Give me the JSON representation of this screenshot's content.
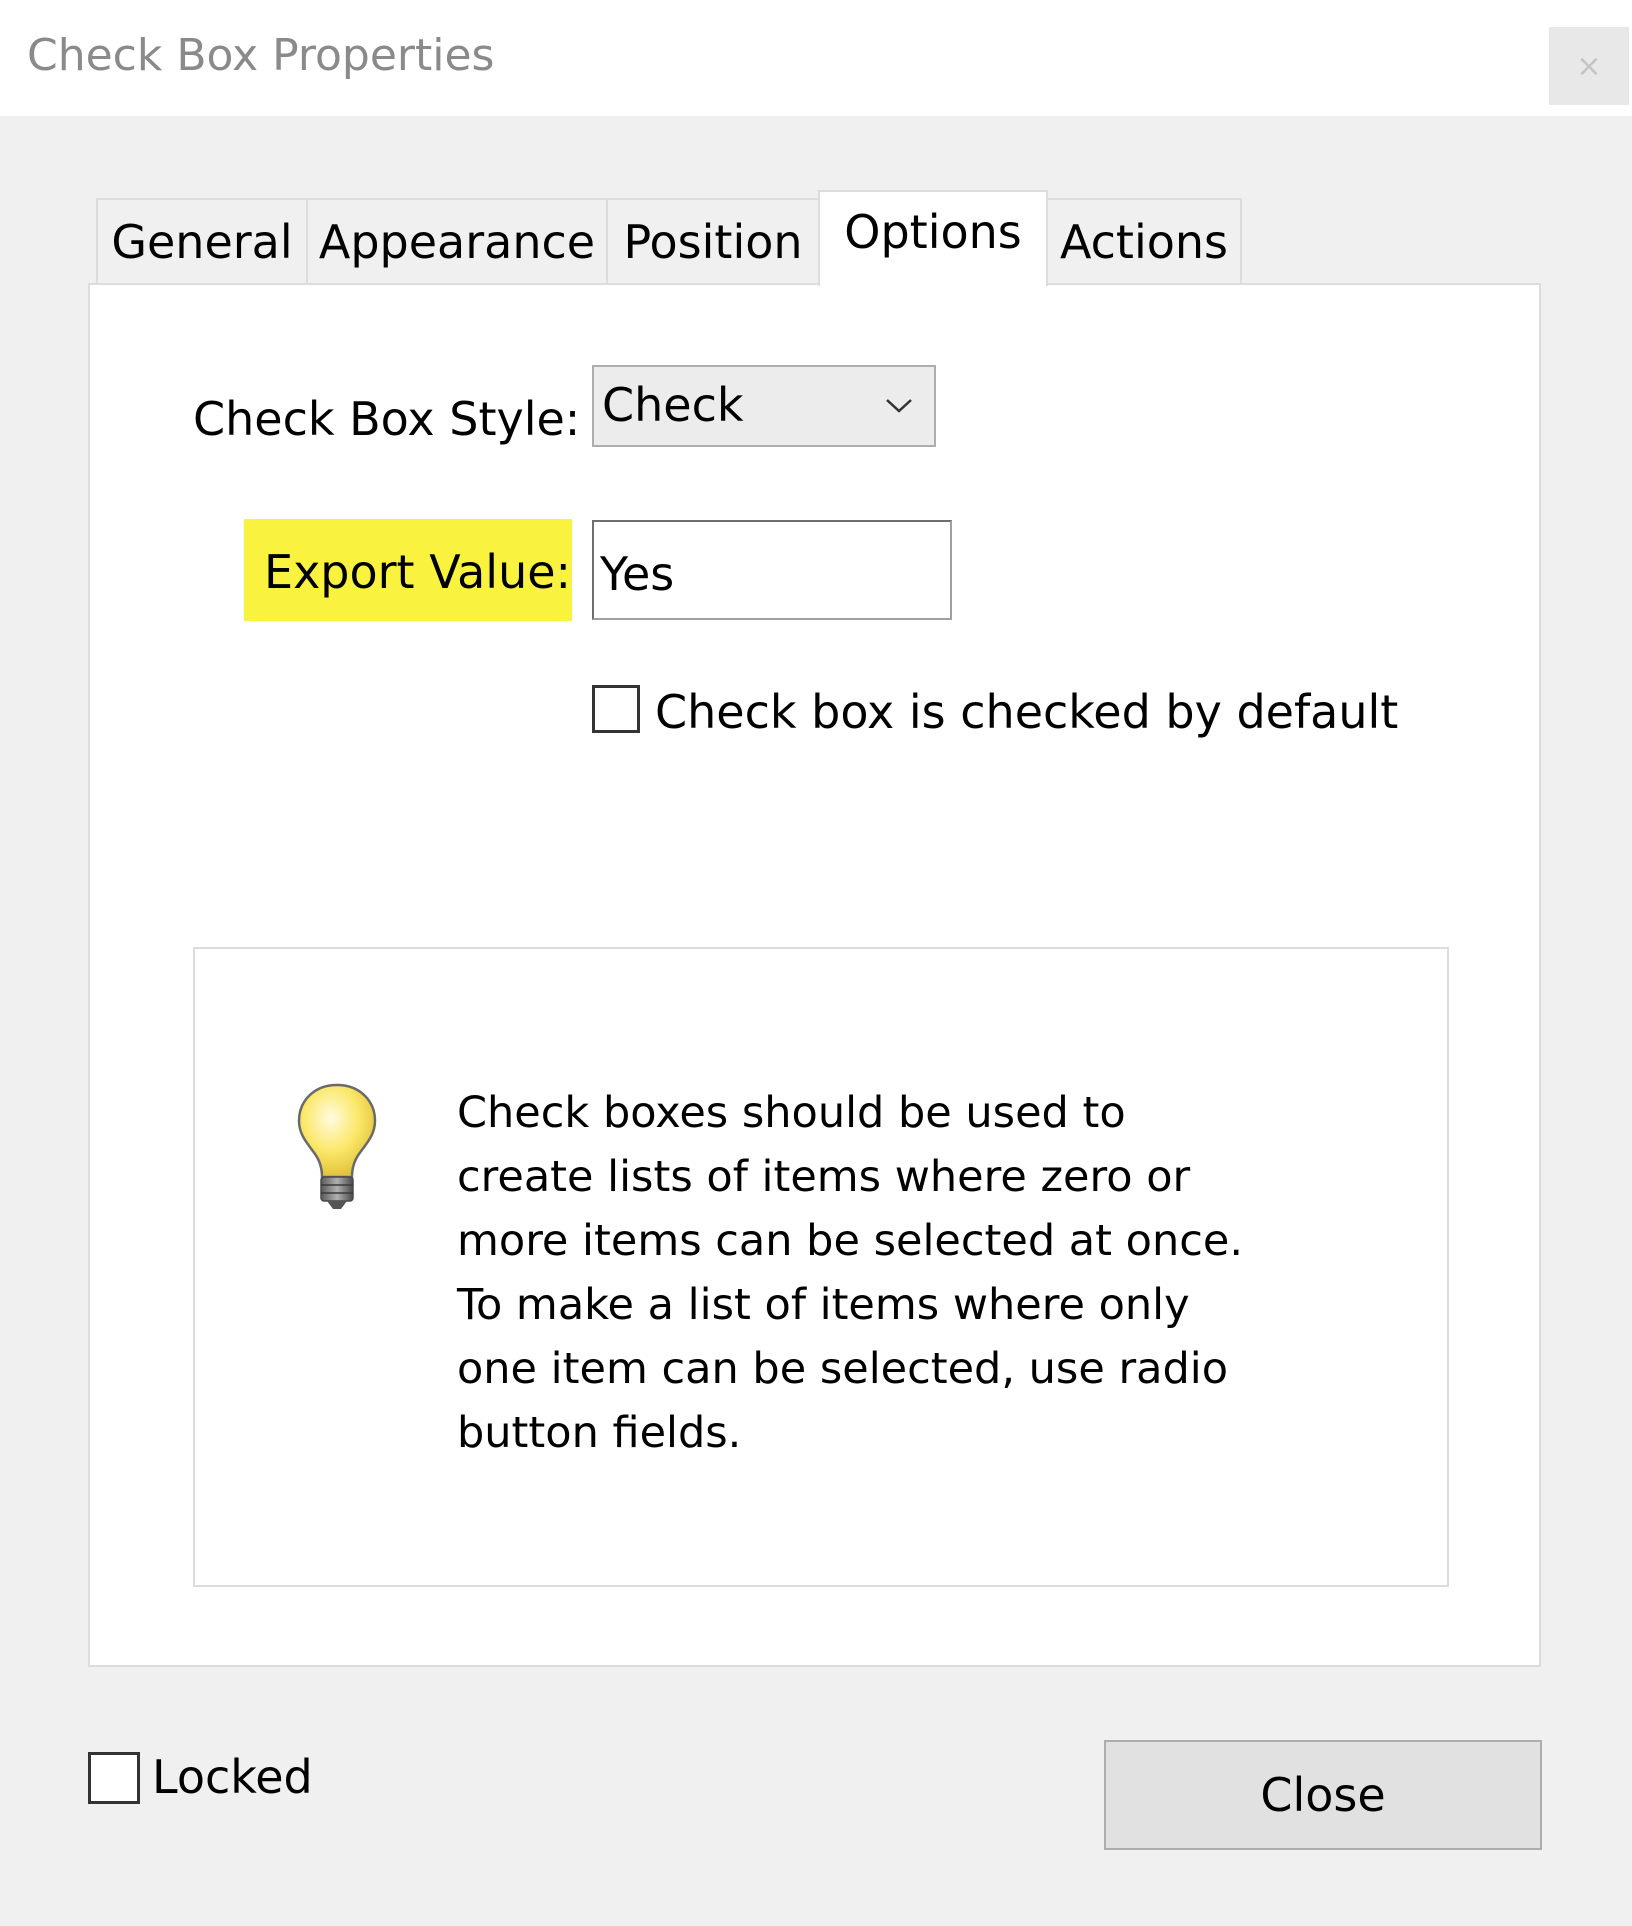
{
  "window": {
    "title": "Check Box Properties",
    "close_glyph": "×"
  },
  "tabs": [
    {
      "label": "General"
    },
    {
      "label": "Appearance"
    },
    {
      "label": "Position"
    },
    {
      "label": "Options",
      "active": true
    },
    {
      "label": "Actions"
    }
  ],
  "options": {
    "style_label": "Check Box Style:",
    "style_value": "Check",
    "export_label": "Export Value:",
    "export_value": "Yes",
    "default_checkbox_label": "Check box is checked by default",
    "default_checked": false
  },
  "tip": {
    "text": "Check boxes should be used to\ncreate lists of items where zero or\nmore items can be selected at once.\nTo make a list of items where only\none item can be selected, use radio\nbutton fields.",
    "icon": "lightbulb-icon"
  },
  "footer": {
    "locked_label": "Locked",
    "locked_checked": false,
    "close_label": "Close"
  },
  "colors": {
    "highlight": "#f9f33f",
    "background": "#f0f0f0",
    "panel": "#ffffff"
  }
}
